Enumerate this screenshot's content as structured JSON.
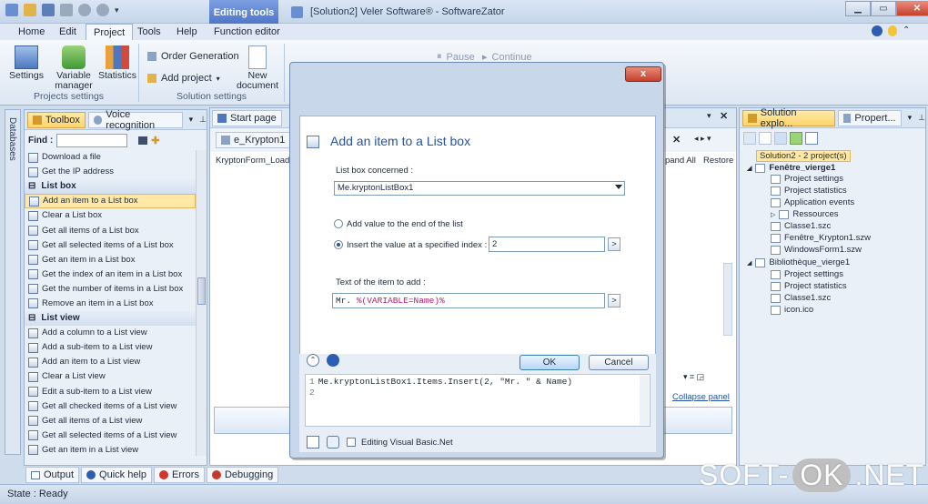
{
  "window": {
    "context_tab": "Editing tools",
    "title": "[Solution2] Veler Software® - SoftwareZator",
    "controls": [
      "▁",
      "▭",
      "✕"
    ]
  },
  "ribbon_tabs": [
    "Home",
    "Edit",
    "Project",
    "Tools",
    "Help",
    "Function editor"
  ],
  "ribbon": {
    "settings": "Settings",
    "variable_manager": "Variable manager",
    "statistics": "Statistics",
    "order_generation": "Order Generation",
    "add_project": "Add project",
    "new_document": "New document",
    "group_projects": "Projects settings",
    "group_solution": "Solution settings",
    "pause": "Pause",
    "continue": "Continue"
  },
  "left_strip": "Databases",
  "toolbox": {
    "tab_toolbox": "Toolbox",
    "tab_voice": "Voice recognition",
    "find_label": "Find :",
    "items": [
      {
        "type": "item",
        "label": "Download a file"
      },
      {
        "type": "item",
        "label": "Get the IP address"
      },
      {
        "type": "head",
        "label": "List box"
      },
      {
        "type": "item",
        "label": "Add an item to a List box",
        "selected": true
      },
      {
        "type": "item",
        "label": "Clear a List box"
      },
      {
        "type": "item",
        "label": "Get all items of a List box"
      },
      {
        "type": "item",
        "label": "Get all selected items of a List box"
      },
      {
        "type": "item",
        "label": "Get an item in a List box"
      },
      {
        "type": "item",
        "label": "Get the index of an item in a List box"
      },
      {
        "type": "item",
        "label": "Get the number of items in a List box"
      },
      {
        "type": "item",
        "label": "Remove an item in a List box"
      },
      {
        "type": "head",
        "label": "List view"
      },
      {
        "type": "item",
        "label": "Add a column to a List view"
      },
      {
        "type": "item",
        "label": "Add a sub-item to a List view"
      },
      {
        "type": "item",
        "label": "Add an item to a List view"
      },
      {
        "type": "item",
        "label": "Clear a List view"
      },
      {
        "type": "item",
        "label": "Edit a sub-item to a List view"
      },
      {
        "type": "item",
        "label": "Get all checked items of a List view"
      },
      {
        "type": "item",
        "label": "Get all items of a List view"
      },
      {
        "type": "item",
        "label": "Get all selected items of a List view"
      },
      {
        "type": "item",
        "label": "Get an item in a List view"
      }
    ]
  },
  "document": {
    "start_page": "Start page",
    "form_tab": "e_Krypton1",
    "event": "KryptonForm_Load",
    "expand_all": "pand All",
    "restore": "Restore",
    "collapse_panel": "Collapse panel"
  },
  "solution_explorer": {
    "tab_solution": "Solution explo...",
    "tab_properties": "Propert...",
    "nodes": [
      {
        "label": "Solution2 - 2 project(s)",
        "level": 0,
        "selected": true
      },
      {
        "label": "Fenêtre_vierge1",
        "level": 0,
        "bold": true,
        "expander": "◢"
      },
      {
        "label": "Project settings",
        "level": 1
      },
      {
        "label": "Project statistics",
        "level": 1
      },
      {
        "label": "Application events",
        "level": 1
      },
      {
        "label": "Ressources",
        "level": 1,
        "expander": "▷"
      },
      {
        "label": "Classe1.szc",
        "level": 1
      },
      {
        "label": "Fenêtre_Krypton1.szw",
        "level": 1
      },
      {
        "label": "WindowsForm1.szw",
        "level": 1
      },
      {
        "label": "Bibliothèque_vierge1",
        "level": 0,
        "expander": "◢"
      },
      {
        "label": "Project settings",
        "level": 1
      },
      {
        "label": "Project statistics",
        "level": 1
      },
      {
        "label": "Classe1.szc",
        "level": 1
      },
      {
        "label": "icon.ico",
        "level": 1
      }
    ]
  },
  "dialog": {
    "title": "Add an item to a List box",
    "close": "x",
    "listbox_label": "List box concerned :",
    "listbox_value": "Me.kryptonListBox1",
    "radio_end": "Add value to the end of the list",
    "radio_index": "Insert the value at a specified index :",
    "index_value": "2",
    "text_label": "Text of the item to add :",
    "text_prefix": "Mr. ",
    "text_var": "%(VARIABLE=Name)%",
    "ok": "OK",
    "cancel": "Cancel",
    "code_line1_no": "1",
    "code_line1": "Me.kryptonListBox1.Items.Insert(2, \"Mr. \" & Name)",
    "code_line2_no": "2",
    "editing_vb": "Editing Visual Basic.Net",
    "browse_btn": ">"
  },
  "bottom_tabs": [
    "Output",
    "Quick help",
    "Errors",
    "Debugging"
  ],
  "status": "State : Ready",
  "watermark": {
    "left": "SOFT-",
    "ok": "OK",
    "right": ".NET"
  }
}
